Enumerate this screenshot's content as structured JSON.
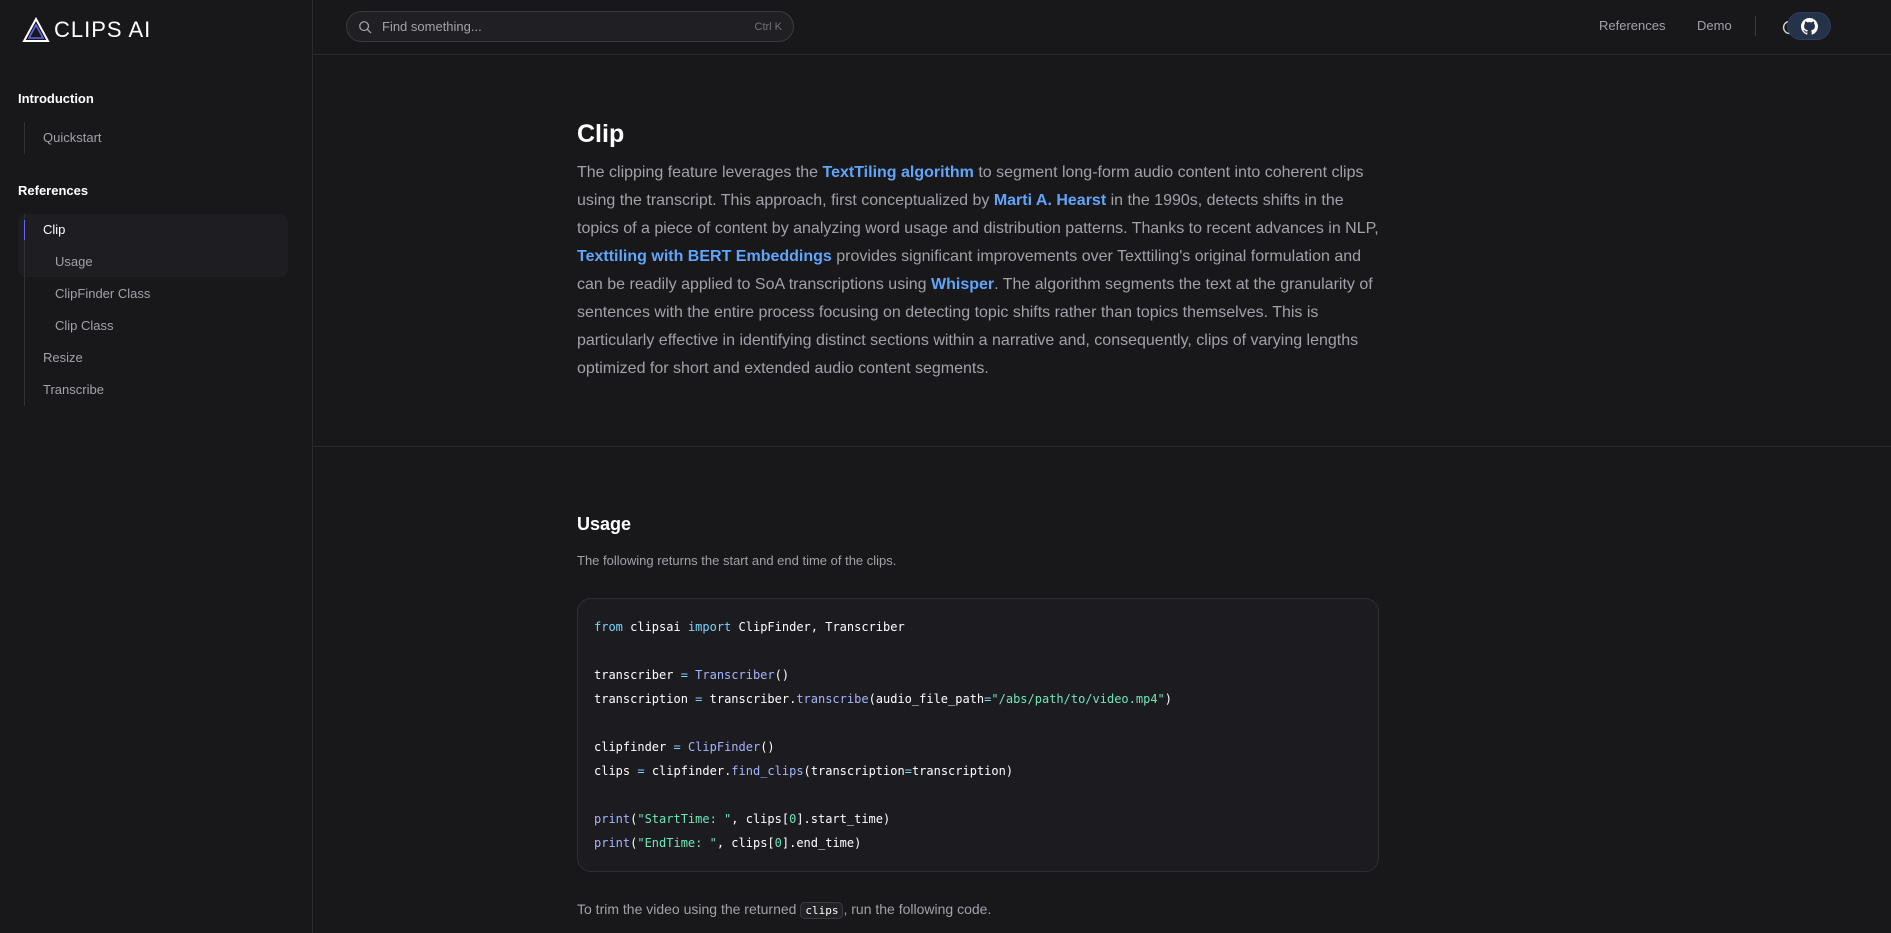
{
  "brand": {
    "name": "CLIPS AI"
  },
  "sidebar": {
    "sections": [
      {
        "title": "Introduction",
        "items": [
          {
            "label": "Quickstart"
          }
        ]
      },
      {
        "title": "References",
        "items": [
          {
            "label": "Clip"
          },
          {
            "label": "Usage"
          },
          {
            "label": "ClipFinder Class"
          },
          {
            "label": "Clip Class"
          },
          {
            "label": "Resize"
          },
          {
            "label": "Transcribe"
          }
        ]
      }
    ]
  },
  "header": {
    "search_placeholder": "Find something...",
    "search_shortcut": "Ctrl K",
    "links": [
      "References",
      "Demo"
    ],
    "icons": {
      "theme": "moon-icon",
      "repo": "github-icon"
    }
  },
  "intro": {
    "title": "Clip",
    "p": {
      "t1": "The clipping feature leverages the ",
      "l1": "TextTiling algorithm",
      "t2": " to segment long-form audio content into coherent clips using the transcript. This approach, first conceptualized by ",
      "l2": "Marti A. Hearst",
      "t3": " in the 1990s, detects shifts in the topics of a piece of content by analyzing word usage and distribution patterns. Thanks to recent advances in NLP, ",
      "l3": "Texttiling with BERT Embeddings",
      "t4": " provides significant improvements over Texttiling's original formulation and can be readily applied to SoA transcriptions using ",
      "l4": "Whisper",
      "t5": ". The algorithm segments the text at the granularity of sentences with the entire process focusing on detecting topic shifts rather than topics themselves. This is particularly effective in identifying distinct sections within a narrative and, consequently, clips of varying lengths optimized for short and extended audio content segments."
    }
  },
  "usage": {
    "title": "Usage",
    "description": "The following returns the start and end time of the clips.",
    "code": {
      "l1": {
        "a": "from",
        "b": " clipsai ",
        "c": "import",
        "d": " ClipFinder, Transcriber"
      },
      "l2": {
        "a": "transcriber ",
        "b": "=",
        "c": " Transcriber",
        "d": "()"
      },
      "l3": {
        "a": "transcription ",
        "b": "=",
        "c": " transcriber.",
        "d": "transcribe",
        "e": "(audio_file_path",
        "f": "=",
        "g": "\"/abs/path/to/video.mp4\"",
        "h": ")"
      },
      "l4": {
        "a": "clipfinder ",
        "b": "=",
        "c": " ClipFinder",
        "d": "()"
      },
      "l5": {
        "a": "clips ",
        "b": "=",
        "c": " clipfinder.",
        "d": "find_clips",
        "e": "(transcription",
        "f": "=",
        "g": "transcription)"
      },
      "l6": {
        "a": "print",
        "b": "(",
        "c": "\"StartTime: \"",
        "d": ", clips[",
        "e": "0",
        "f": "].start_time)"
      },
      "l7": {
        "a": "print",
        "b": "(",
        "c": "\"EndTime: \"",
        "d": ", clips[",
        "e": "0",
        "f": "].end_time)"
      }
    },
    "trim_text_before": "To trim the video using the returned ",
    "trim_code": "clips",
    "trim_text_after": ", run the following code."
  }
}
